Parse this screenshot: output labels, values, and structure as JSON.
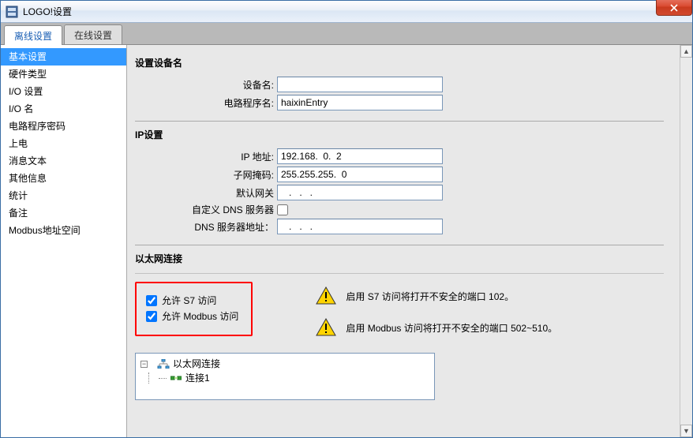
{
  "window": {
    "title": "LOGO!设置"
  },
  "tabs": {
    "offline": "离线设置",
    "online": "在线设置"
  },
  "sidebar": {
    "items": [
      "基本设置",
      "硬件类型",
      "I/O 设置",
      "I/O 名",
      "电路程序密码",
      "上电",
      "消息文本",
      "其他信息",
      "统计",
      "备注",
      "Modbus地址空间"
    ],
    "selectedIndex": 0
  },
  "section_device": {
    "heading": "设置设备名",
    "labels": {
      "device": "设备名:",
      "program": "电路程序名:"
    },
    "values": {
      "device": "",
      "program": "haixinEntry"
    }
  },
  "section_ip": {
    "heading": "IP设置",
    "labels": {
      "ip": "IP 地址:",
      "mask": "子网掩码:",
      "gw": "默认网关",
      "customdns": "自定义 DNS 服务器",
      "dnsaddr": "DNS 服务器地址："
    },
    "values": {
      "ip": "192.168.  0.  2",
      "mask": "255.255.255.  0",
      "gw": "   .   .   .   ",
      "customdns": false,
      "dnsaddr": "   .   .   .   "
    }
  },
  "section_eth": {
    "heading": "以太网连接",
    "allow_s7": {
      "label": "允许 S7 访问",
      "checked": true
    },
    "allow_modbus": {
      "label": "允许 Modbus 访问",
      "checked": true
    },
    "warn_s7": "启用 S7 访问将打开不安全的端口 102。",
    "warn_modbus": "启用 Modbus 访问将打开不安全的端口 502~510。",
    "tree": {
      "root": "以太网连接",
      "child": "连接1"
    }
  }
}
